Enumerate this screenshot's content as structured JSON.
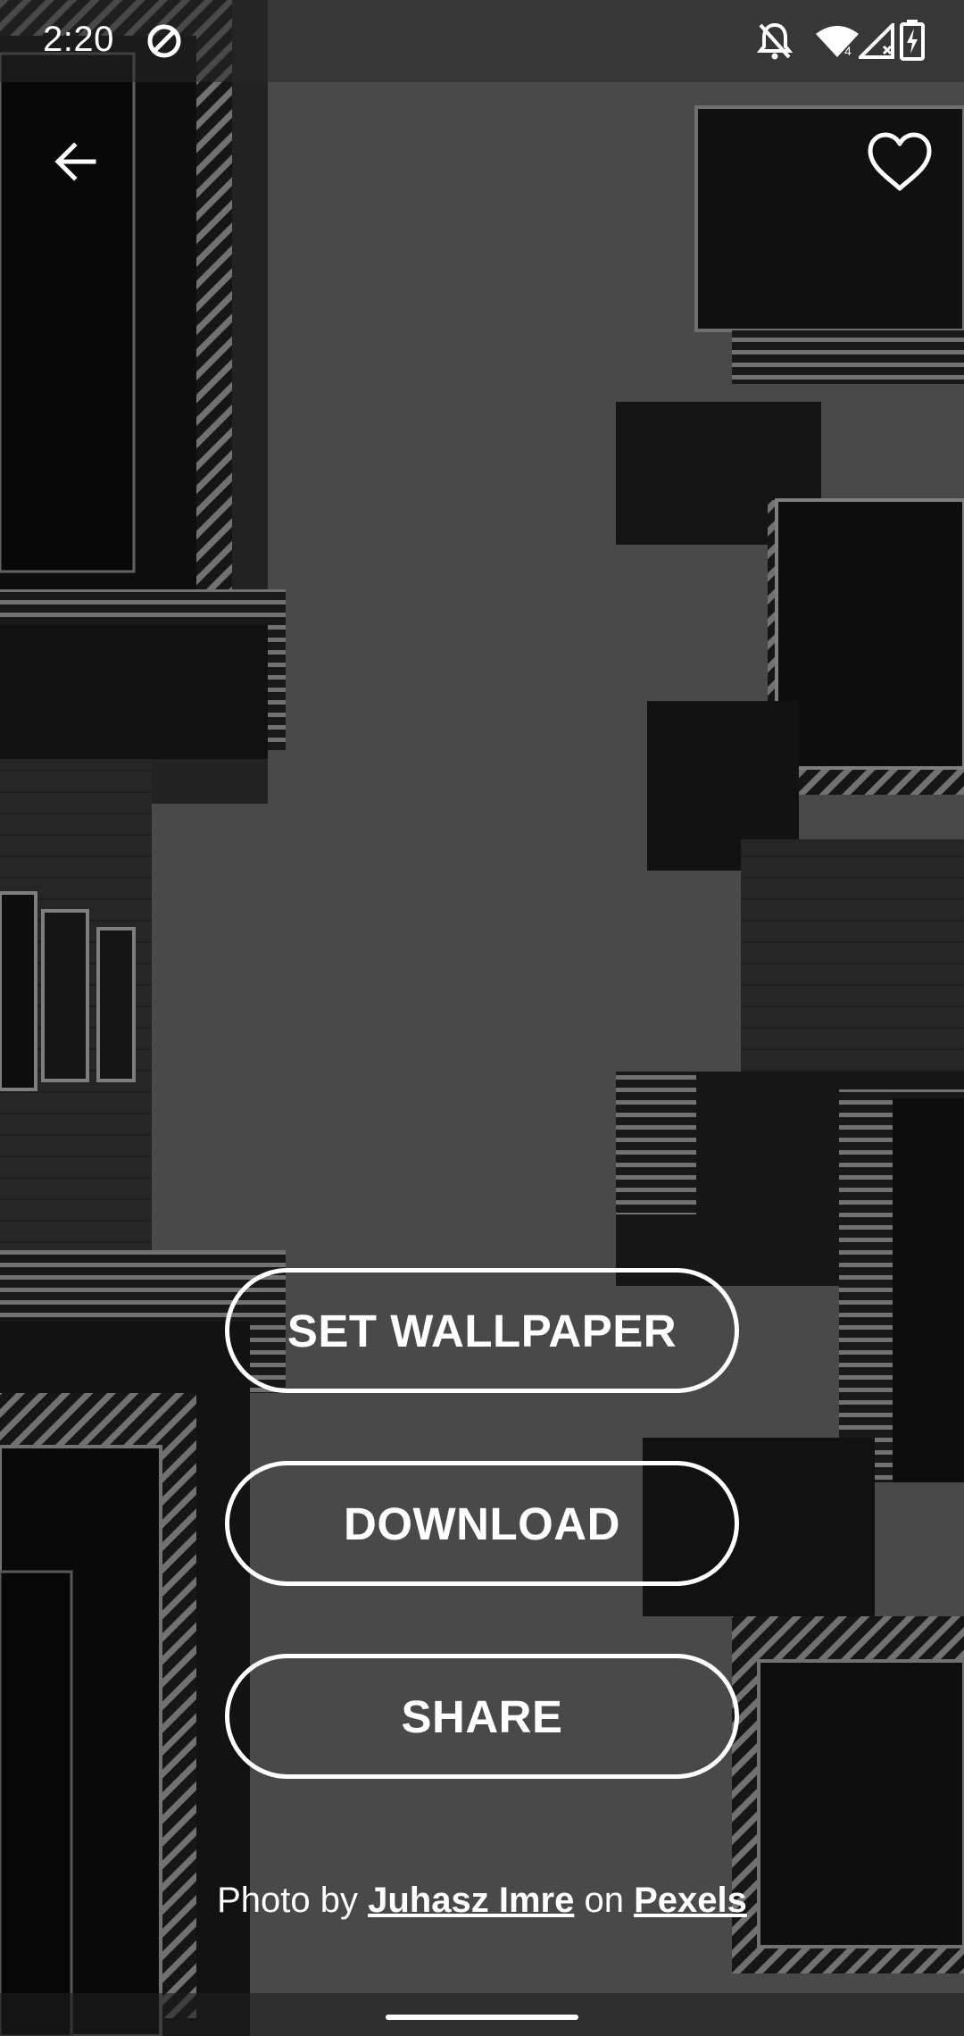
{
  "status_bar": {
    "time": "2:20",
    "icons": [
      "data-saver-icon",
      "notifications-off-icon",
      "wifi-icon",
      "cellular-signal-icon",
      "battery-charging-icon"
    ]
  },
  "top_bar": {
    "back_icon": "arrow-back-icon",
    "favorite_icon": "heart-outline-icon"
  },
  "actions": {
    "set_wallpaper": "SET WALLPAPER",
    "download": "DOWNLOAD",
    "share": "SHARE"
  },
  "credit": {
    "prefix": "Photo by",
    "author": "Juhasz Imre",
    "middle": "on",
    "source": "Pexels"
  },
  "colors": {
    "overlay": "#595959",
    "foreground": "#ffffff"
  }
}
